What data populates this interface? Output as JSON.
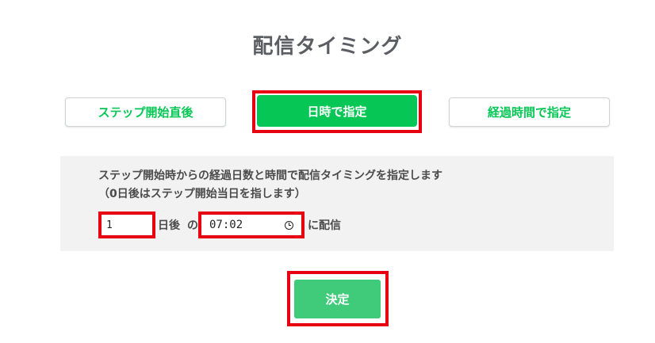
{
  "page": {
    "title": "配信タイミング"
  },
  "tabs": [
    {
      "label": "ステップ開始直後",
      "active": false
    },
    {
      "label": "日時で指定",
      "active": true
    },
    {
      "label": "経過時間で指定",
      "active": false
    }
  ],
  "panel": {
    "description_line1": "ステップ開始時からの経過日数と時間で配信タイミングを指定します",
    "description_line2": "（0日後はステップ開始当日を指します）",
    "day_value": "1",
    "days_label": "日後",
    "no_label": "の",
    "time_value": "07:02",
    "deliver_label": "に配信"
  },
  "actions": {
    "confirm_label": "決定"
  },
  "colors": {
    "accent": "#06c755",
    "confirm": "#3fcb79",
    "highlight": "#e60012",
    "panel_bg": "#f2f2f2"
  },
  "icons": {
    "time_picker": "clock-icon"
  }
}
